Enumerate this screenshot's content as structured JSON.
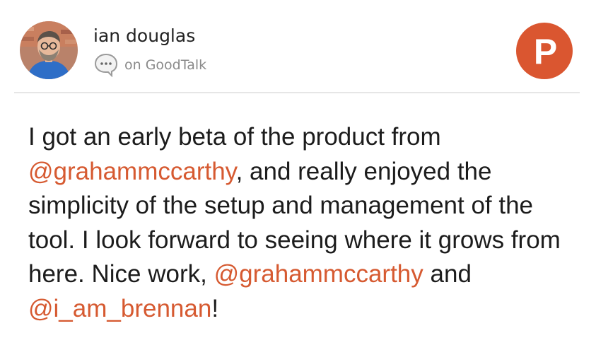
{
  "post": {
    "author": "ian douglas",
    "source_label": "on GoodTalk",
    "badge_letter": "P",
    "body_segments": [
      "I got an early beta of the product from",
      "@grahammccarthy",
      ", and really enjoyed the simplicity of the setup and management of the tool. I look forward to seeing where it grows from here. Nice work,",
      "@grahammccarthy",
      "and",
      "@i_am_brennan",
      "!"
    ]
  },
  "colors": {
    "accent": "#da5630",
    "mention": "#d65a31",
    "divider": "#e6e6e6",
    "secondary_text": "#8a8a8a"
  },
  "icons": {
    "avatar": "avatar",
    "source": "chat-bubble-icon",
    "badge": "product-hunt-logo"
  }
}
